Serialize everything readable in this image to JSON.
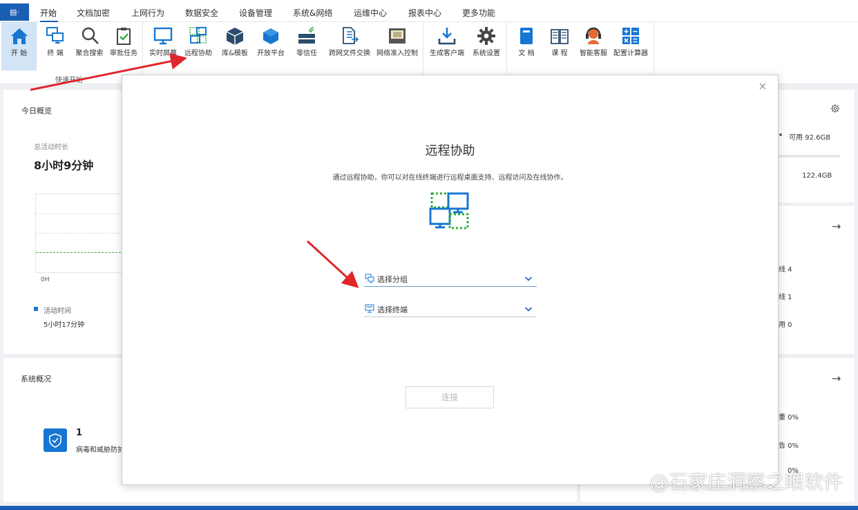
{
  "menubar": {
    "app_label": "▤·",
    "items": [
      "开始",
      "文档加密",
      "上网行为",
      "数据安全",
      "设备管理",
      "系统&网络",
      "运维中心",
      "报表中心",
      "更多功能"
    ]
  },
  "ribbon": {
    "buttons": [
      {
        "label": "开 始",
        "icon": "home-icon"
      },
      {
        "label": "终 端",
        "icon": "terminal-icon"
      },
      {
        "label": "聚合搜索",
        "icon": "search-icon"
      },
      {
        "label": "审批任务",
        "icon": "clipboard-check-icon"
      },
      {
        "label": "实时屏幕",
        "icon": "monitor-icon"
      },
      {
        "label": "远程协助",
        "icon": "remote-assist-icon"
      },
      {
        "label": "库&模板",
        "icon": "cube-icon"
      },
      {
        "label": "开放平台",
        "icon": "hexagon-icon"
      },
      {
        "label": "零信任",
        "icon": "server-wifi-icon"
      },
      {
        "label": "跨网文件交换",
        "icon": "file-exchange-icon"
      },
      {
        "label": "网络准入控制",
        "icon": "network-access-icon"
      },
      {
        "label": "生成客户端",
        "icon": "download-icon"
      },
      {
        "label": "系统设置",
        "icon": "gear-icon"
      },
      {
        "label": "文 档",
        "icon": "book-icon"
      },
      {
        "label": "课 程",
        "icon": "open-book-icon"
      },
      {
        "label": "智能客服",
        "icon": "headset-icon"
      },
      {
        "label": "配置计算器",
        "icon": "calculator-icon"
      }
    ],
    "group_label": "快速开始"
  },
  "background": {
    "today_title": "今日概览",
    "total_active_label": "总活动时长",
    "total_active_value": "8小时9分钟",
    "axis_label": "0H",
    "legend_active": "活动时间",
    "legend_active_value": "5小时17分钟",
    "available_label": "可用 92.6GB",
    "total_storage": "122.4GB",
    "online_label": "线 4",
    "offline_label": "线 1",
    "disabled_label": "用 0",
    "system_title": "系统概况",
    "virus_count": "1",
    "virus_label": "病毒和威胁防护",
    "right_pct1_label": "重 0%",
    "right_pct2_label": "告 0%",
    "right_pct3_label": "0%"
  },
  "modal": {
    "title": "远程协助",
    "description": "通过远程协助，你可以对在线终端进行远程桌面支持、远程访问及在线协作。",
    "select_group_placeholder": "选择分组",
    "select_terminal_placeholder": "选择终端",
    "connect_label": "连接",
    "close_label": "×"
  },
  "watermark": "@石家庄洞察之眼软件",
  "colors": {
    "accent": "#1a5fb4",
    "icon_blue": "#1677d2",
    "green_dashed": "#2fae3a"
  }
}
